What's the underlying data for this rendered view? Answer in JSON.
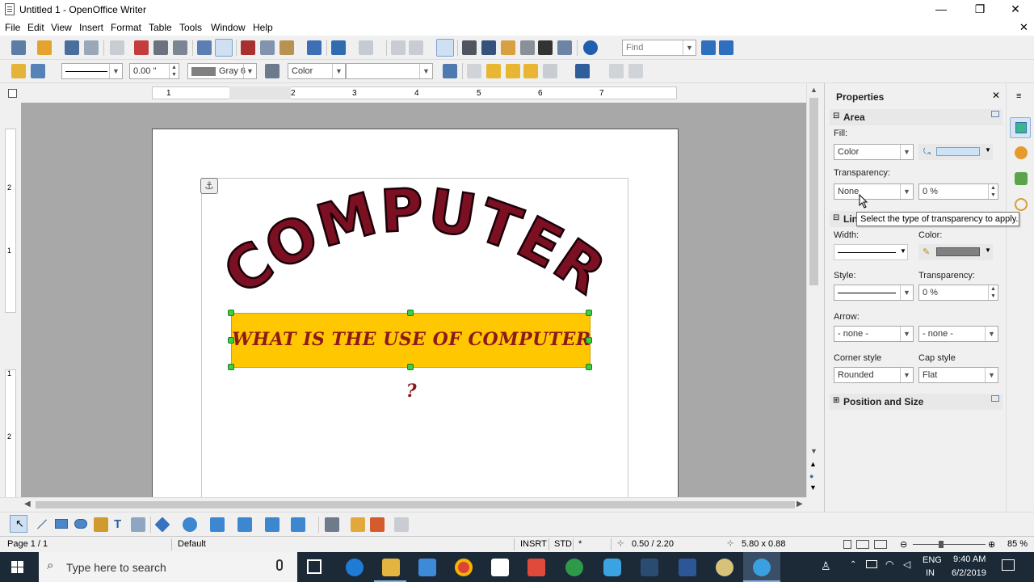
{
  "window": {
    "title": "Untitled 1 - OpenOffice Writer",
    "minimize_glyph": "—",
    "maximize_glyph": "❐",
    "close_glyph": "✕",
    "doc_close_glyph": "✕"
  },
  "menubar": {
    "items": [
      "File",
      "Edit",
      "View",
      "Insert",
      "Format",
      "Table",
      "Tools",
      "Window",
      "Help"
    ]
  },
  "standard_toolbar": {
    "find_placeholder": "Find"
  },
  "drawing_properties_bar": {
    "line_width_value": "0.00 \"",
    "line_color_value": "Gray 6",
    "area_style_value": "Color",
    "area_fill_value": ""
  },
  "ruler": {
    "h_numbers": [
      "1",
      "1",
      "2",
      "3",
      "4",
      "5",
      "6",
      "7"
    ],
    "v_numbers": [
      "2",
      "1",
      "1",
      "2"
    ]
  },
  "document": {
    "wordart_letters": [
      "C",
      "O",
      "M",
      "P",
      "U",
      "T",
      "E",
      "R"
    ],
    "banner_text": "WHAT IS THE USE OF COMPUTER ?",
    "anchor_glyph": "⚓"
  },
  "sidebar": {
    "title": "Properties",
    "close_glyph": "✕",
    "area_section": "Area",
    "fill_label": "Fill:",
    "fill_value": "Color",
    "transparency_label": "Transparency:",
    "transparency_type": "None",
    "transparency_value": "0 %",
    "line_section": "Line",
    "width_label": "Width:",
    "color_label": "Color:",
    "style_label": "Style:",
    "line_transparency_label": "Transparency:",
    "line_transparency_value": "0 %",
    "arrow_label": "Arrow:",
    "arrow_start": "- none -",
    "arrow_end": "- none -",
    "corner_style_label": "Corner style",
    "corner_style_value": "Rounded",
    "cap_style_label": "Cap style",
    "cap_style_value": "Flat",
    "position_size_section": "Position and Size",
    "tooltip": "Select the type of transparency to apply."
  },
  "statusbar": {
    "page": "Page 1 / 1",
    "style": "Default",
    "insert_mode": "INSRT",
    "selection_mode": "STD",
    "modified": "*",
    "position": "0.50 / 2.20",
    "size": "5.80 x 0.88",
    "zoom": "85 %"
  },
  "taskbar": {
    "search_placeholder": "Type here to search",
    "language_top": "ENG",
    "language_bottom": "IN",
    "time": "9:40 AM",
    "date": "6/2/2019"
  },
  "colors": {
    "wordart": "#7a1022",
    "banner_fill": "#ffc700",
    "banner_text": "#8b1a1a",
    "handle": "#3dcf3d",
    "taskbar": "#1c2a38"
  }
}
